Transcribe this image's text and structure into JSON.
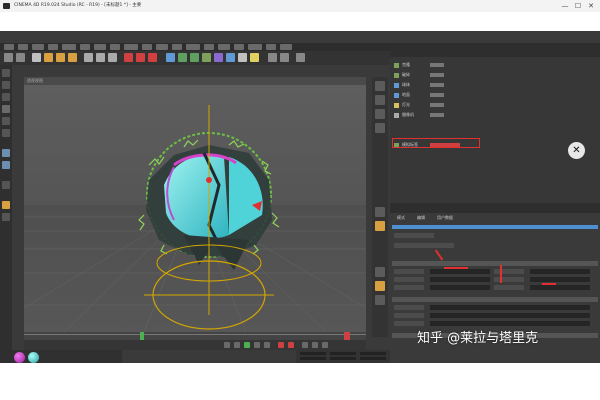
{
  "window": {
    "title": "CINEMA 4D R19.024 Studio (RC - R19) - [未标题1 *] - 主要",
    "minimize_glyph": "—",
    "maximize_glyph": "☐",
    "close_glyph": "✕"
  },
  "viewport": {
    "header_label": "透视视图"
  },
  "object_manager": {
    "items": [
      {
        "label": "克隆",
        "color": "#7da05a"
      },
      {
        "label": "破碎",
        "color": "#7da05a"
      },
      {
        "label": "球体",
        "color": "#5f9ad6"
      },
      {
        "label": "地面",
        "color": "#5f9ad6"
      },
      {
        "label": "灯光",
        "color": "#d6c05f"
      },
      {
        "label": "摄像机",
        "color": "#aaaaaa"
      },
      {
        "label": "模拟标签",
        "color": "#7da05a"
      }
    ]
  },
  "attributes": {
    "tabs": [
      "模式",
      "编辑",
      "用户数据"
    ]
  },
  "colors": {
    "app_bg": "#3a3a3a",
    "viewport_bg": "#5a5a5a",
    "highlight_red": "#e03030",
    "accent_green": "#4caf50",
    "axis_yellow": "#d4a600"
  },
  "watermark": {
    "text": "知乎 @莱拉与塔里克"
  },
  "icons": {
    "cube_logo": "cinema4d-logo-icon"
  }
}
